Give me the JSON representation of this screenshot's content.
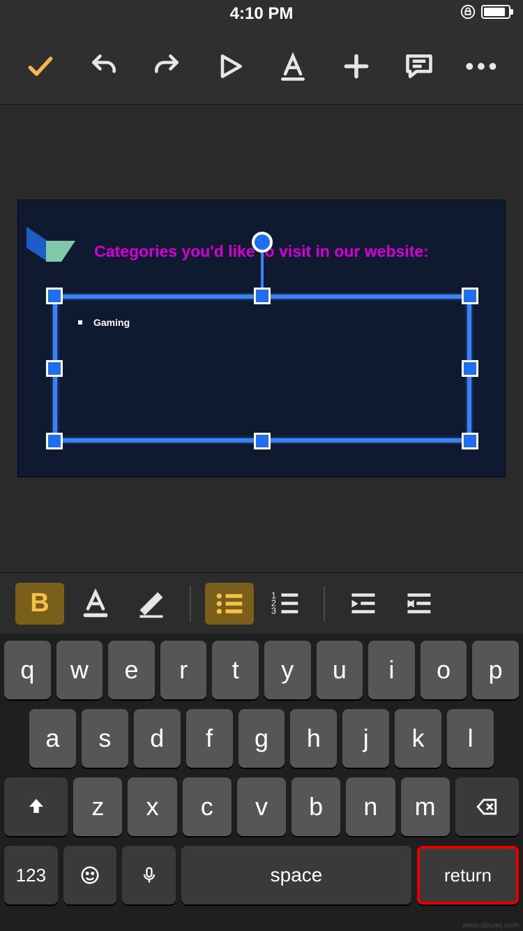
{
  "status": {
    "time": "4:10 PM"
  },
  "slide": {
    "title": "Categories you'd like to visit in our website:",
    "bullets": [
      "Gaming"
    ]
  },
  "format_buttons": {
    "bold": "B"
  },
  "keyboard": {
    "row1": [
      "q",
      "w",
      "e",
      "r",
      "t",
      "y",
      "u",
      "i",
      "o",
      "p"
    ],
    "row2": [
      "a",
      "s",
      "d",
      "f",
      "g",
      "h",
      "j",
      "k",
      "l"
    ],
    "row3": [
      "z",
      "x",
      "c",
      "v",
      "b",
      "n",
      "m"
    ],
    "mode": "123",
    "space": "space",
    "return": "return"
  },
  "watermark": "www.deuaq.com"
}
